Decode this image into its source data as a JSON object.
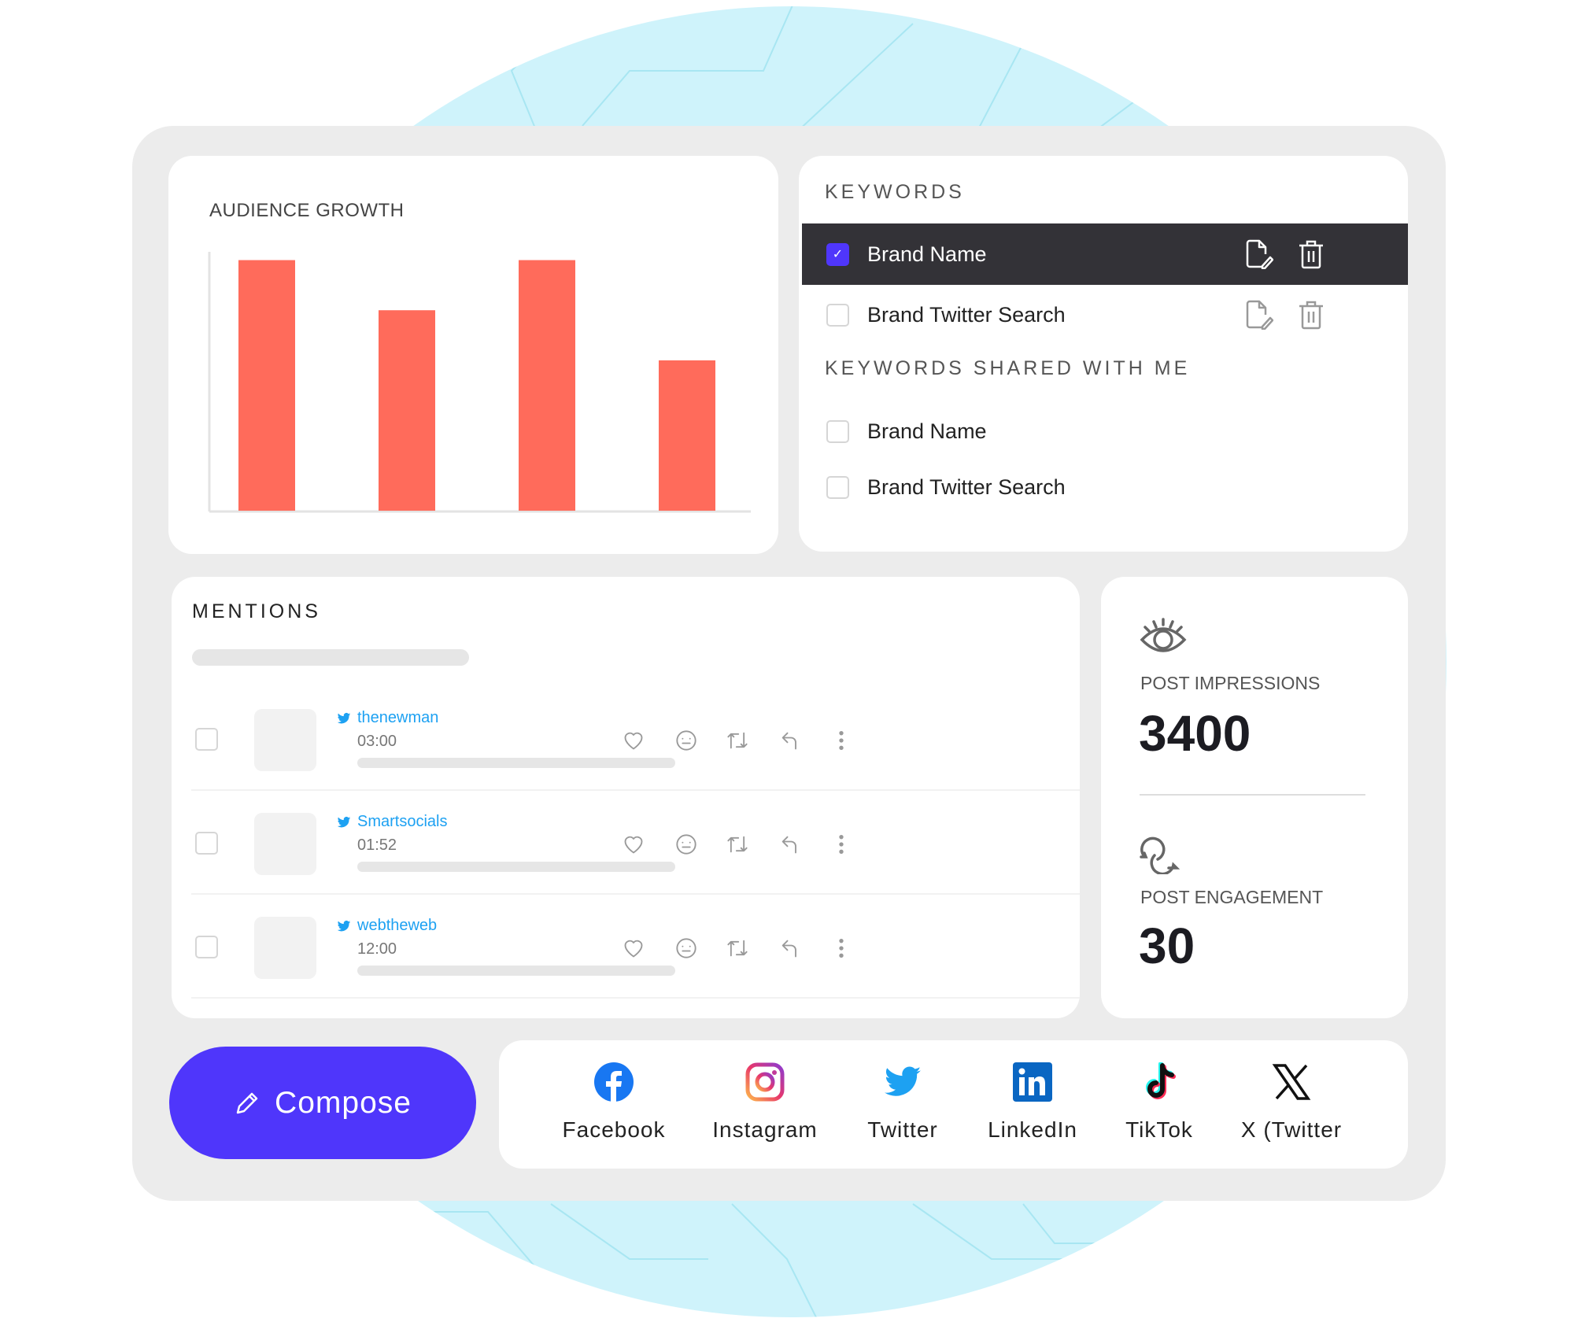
{
  "colors": {
    "accent": "#4f36fb",
    "bar": "#ff6b5b",
    "selected_row": "#333237",
    "twitter": "#1da1f2",
    "background_circle": "#cff3fb"
  },
  "audience_growth": {
    "title": "AUDIENCE GROWTH"
  },
  "chart_data": {
    "type": "bar",
    "title": "AUDIENCE GROWTH",
    "categories": [
      "",
      "",
      "",
      ""
    ],
    "values": [
      5,
      4,
      5,
      3
    ],
    "ylim": [
      0,
      5.15
    ],
    "xlabel": "",
    "ylabel": "",
    "grid": false
  },
  "keywords": {
    "title": "KEYWORDS",
    "items": [
      {
        "label": "Brand Name",
        "checked": true
      },
      {
        "label": "Brand Twitter Search",
        "checked": false
      }
    ],
    "shared_title": "KEYWORDS SHARED WITH ME",
    "shared_items": [
      {
        "label": "Brand Name",
        "checked": false
      },
      {
        "label": "Brand Twitter Search",
        "checked": false
      }
    ]
  },
  "mentions": {
    "title": "MENTIONS",
    "items": [
      {
        "user": "thenewman",
        "time": "03:00"
      },
      {
        "user": "Smartsocials",
        "time": "01:52"
      },
      {
        "user": "webtheweb",
        "time": "12:00"
      }
    ],
    "actions": [
      "heart-icon",
      "emoji-icon",
      "retweet-icon",
      "reply-icon",
      "more-icon"
    ]
  },
  "stats": {
    "impressions_label": "POST IMPRESSIONS",
    "impressions_value": "3400",
    "engagement_label": "POST ENGAGEMENT",
    "engagement_value": "30"
  },
  "compose": {
    "label": "Compose",
    "icon": "pencil-icon"
  },
  "networks": [
    {
      "label": "Facebook"
    },
    {
      "label": "Instagram"
    },
    {
      "label": "Twitter"
    },
    {
      "label": "LinkedIn"
    },
    {
      "label": "TikTok"
    },
    {
      "label": "X (Twitter"
    }
  ]
}
